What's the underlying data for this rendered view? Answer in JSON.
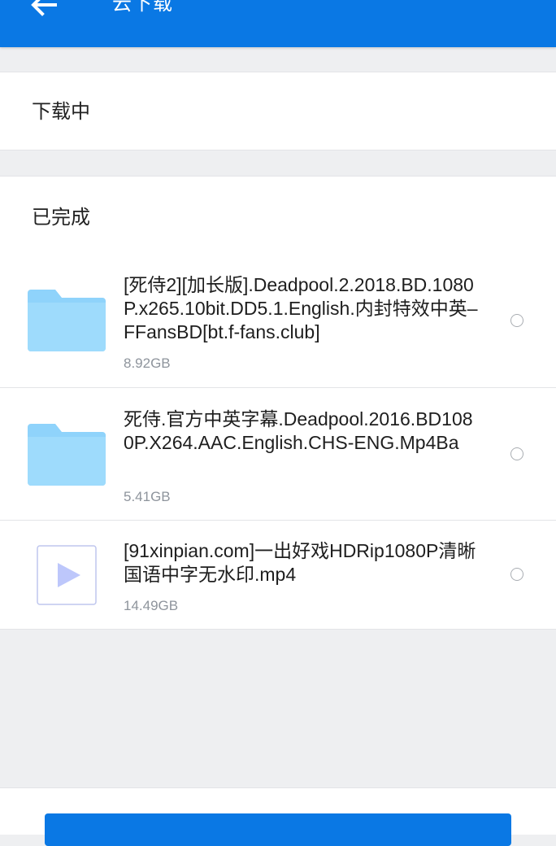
{
  "header": {
    "title": "云下载",
    "back_icon": "arrow-left-icon",
    "color": "#0a78e4"
  },
  "sections": {
    "downloading_label": "下载中",
    "completed_label": "已完成"
  },
  "files": [
    {
      "name": "[死侍2][加长版].Deadpool.2.2018.BD.1080P.x265.10bit.DD5.1.English.内封特效中英–FFansBD[bt.f-fans.club]",
      "size": "8.92GB",
      "icon": "folder-icon",
      "selected": false
    },
    {
      "name": "死侍.官方中英字幕.Deadpool.2016.BD1080P.X264.AAC.English.CHS-ENG.Mp4Ba",
      "size": "5.41GB",
      "icon": "folder-icon",
      "selected": false
    },
    {
      "name": "[91xinpian.com]一出好戏HDRip1080P清晰国语中字无水印.mp4",
      "size": "14.49GB",
      "icon": "video-file-icon",
      "selected": false
    }
  ],
  "colors": {
    "accent": "#0a78e4",
    "folder": "#8fd3fb",
    "page_background": "#eeeff1",
    "play_triangle": "#bdc7fb"
  }
}
